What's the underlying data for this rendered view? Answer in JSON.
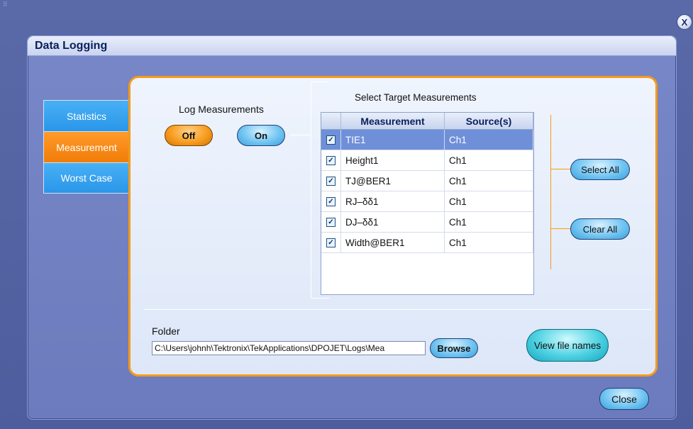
{
  "window": {
    "close_glyph": "X"
  },
  "dialog": {
    "title": "Data Logging"
  },
  "tabs": [
    {
      "label": "Statistics",
      "active": false
    },
    {
      "label": "Measurement",
      "active": true
    },
    {
      "label": "Worst Case",
      "active": false
    }
  ],
  "log": {
    "label": "Log Measurements",
    "off_label": "Off",
    "on_label": "On",
    "state": "Off"
  },
  "targets": {
    "title": "Select Target Measurements",
    "columns": [
      "Measurement",
      "Source(s)"
    ],
    "rows": [
      {
        "measurement": "TIE1",
        "source": "Ch1",
        "checked": true,
        "selected": true
      },
      {
        "measurement": "Height1",
        "source": "Ch1",
        "checked": true,
        "selected": false
      },
      {
        "measurement": "TJ@BER1",
        "source": "Ch1",
        "checked": true,
        "selected": false
      },
      {
        "measurement": "RJ–δδ1",
        "source": "Ch1",
        "checked": true,
        "selected": false
      },
      {
        "measurement": "DJ–δδ1",
        "source": "Ch1",
        "checked": true,
        "selected": false
      },
      {
        "measurement": "Width@BER1",
        "source": "Ch1",
        "checked": true,
        "selected": false
      }
    ],
    "select_all_label": "Select All",
    "clear_all_label": "Clear All"
  },
  "folder": {
    "label": "Folder",
    "path": "C:\\Users\\johnh\\Tektronix\\TekApplications\\DPOJET\\Logs\\Mea",
    "browse_label": "Browse",
    "view_names_label": "View file names"
  },
  "footer": {
    "close_label": "Close"
  },
  "colors": {
    "accent_orange": "#f59a1b",
    "tab_blue": "#2a96e8",
    "selected_row": "#6f8fd9",
    "background": "#4d5d9d"
  }
}
